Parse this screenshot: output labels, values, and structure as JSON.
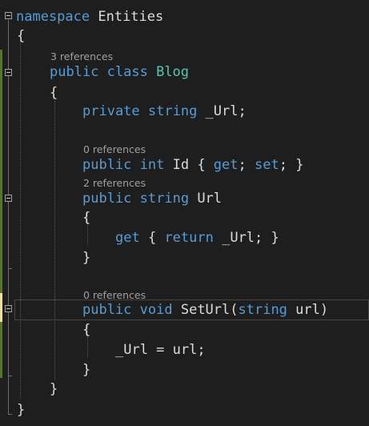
{
  "editor": {
    "language": "C#",
    "colors": {
      "background": "#1e1e1e",
      "keyword": "#569cd6",
      "type": "#4ec9b0",
      "identifier": "#dcdcdc",
      "codelens": "#a0a0a0",
      "change_saved": "#577430",
      "change_unsaved": "#efe29a"
    },
    "codelens": {
      "blog_refs": "3 references",
      "id_refs": "0 references",
      "url_refs": "2 references",
      "seturl_refs": "0 references"
    },
    "tokens": {
      "namespace_kw": "namespace",
      "namespace_name": " Entities",
      "brace_open": "{",
      "brace_close": "}",
      "public_kw": "public",
      "private_kw": "private",
      "class_kw": " class",
      "class_name": " Blog",
      "string_kw": " string",
      "int_kw": " int",
      "void_kw": " void",
      "url_field": " _Url;",
      "id_prop": " Id { ",
      "get_kw": "get",
      "semi_sp": "; ",
      "set_kw": "set",
      "semi_close": "; }",
      "url_prop": " Url",
      "get_open": " { ",
      "return_kw": "return",
      "return_val": " _Url; }",
      "seturl_name": " SetUrl(",
      "string_param_kw": "string",
      "param_close": " url)",
      "assign_stmt": "_Url = url;"
    }
  }
}
